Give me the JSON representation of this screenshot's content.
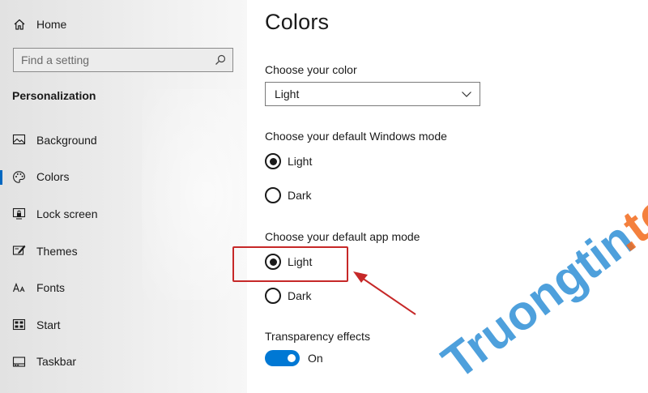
{
  "sidebar": {
    "home_label": "Home",
    "search_placeholder": "Find a setting",
    "section_title": "Personalization",
    "items": [
      {
        "label": "Background",
        "icon": "image-icon"
      },
      {
        "label": "Colors",
        "icon": "palette-icon",
        "active": true
      },
      {
        "label": "Lock screen",
        "icon": "lock-screen-icon"
      },
      {
        "label": "Themes",
        "icon": "themes-icon"
      },
      {
        "label": "Fonts",
        "icon": "fonts-icon"
      },
      {
        "label": "Start",
        "icon": "start-icon"
      },
      {
        "label": "Taskbar",
        "icon": "taskbar-icon"
      }
    ]
  },
  "main": {
    "title": "Colors",
    "choose_color": {
      "label": "Choose your color",
      "selected": "Light"
    },
    "windows_mode": {
      "label": "Choose your default Windows mode",
      "options": [
        {
          "label": "Light",
          "checked": true
        },
        {
          "label": "Dark",
          "checked": false
        }
      ]
    },
    "app_mode": {
      "label": "Choose your default app mode",
      "options": [
        {
          "label": "Light",
          "checked": true
        },
        {
          "label": "Dark",
          "checked": false
        }
      ]
    },
    "transparency": {
      "label": "Transparency effects",
      "state_label": "On",
      "on": true
    }
  },
  "colors": {
    "accent": "#0078d4",
    "annotation": "#c62828",
    "watermark_primary": "#2f8fd6",
    "watermark_accent": "#f26a1b"
  },
  "watermark": {
    "text": "Truongtin",
    "suffix": ".top"
  }
}
